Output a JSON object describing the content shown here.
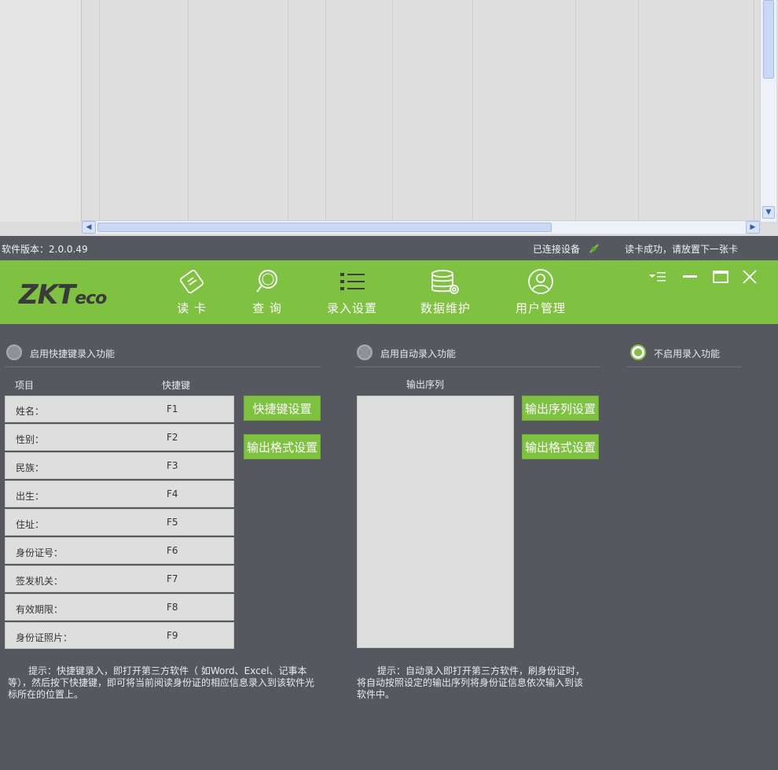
{
  "status": {
    "version": "软件版本：2.0.0.49",
    "connected": "已连接设备",
    "read_status": "读卡成功，请放置下一张卡"
  },
  "toolbar": {
    "logo_main": "ZKT",
    "logo_sub": "eco",
    "items": [
      {
        "label": "读 卡",
        "icon": "id-card-icon"
      },
      {
        "label": "查 询",
        "icon": "magnifier-icon"
      },
      {
        "label": "录入设置",
        "icon": "checklist-icon"
      },
      {
        "label": "数据维护",
        "icon": "database-gear-icon"
      },
      {
        "label": "用户管理",
        "icon": "user-icon"
      }
    ]
  },
  "panel": {
    "radio_hotkey": "启用快捷键录入功能",
    "radio_auto": "启用自动录入功能",
    "radio_off": "不启用录入功能",
    "selected": "radio_off",
    "col_item": "项目",
    "col_key": "快捷键",
    "rows": [
      {
        "name": "姓名：",
        "key": "F1"
      },
      {
        "name": "性别：",
        "key": "F2"
      },
      {
        "name": "民族：",
        "key": "F3"
      },
      {
        "name": "出生：",
        "key": "F4"
      },
      {
        "name": "住址：",
        "key": "F5"
      },
      {
        "name": "身份证号：",
        "key": "F6"
      },
      {
        "name": "签发机关：",
        "key": "F7"
      },
      {
        "name": "有效期限：",
        "key": "F8"
      },
      {
        "name": "身份证照片：",
        "key": "F9"
      }
    ],
    "btn_hotkey_set": "快捷键设置",
    "btn_format_left": "输出格式设置",
    "output_label": "输出序列",
    "btn_seq_set": "输出序列设置",
    "btn_format_right": "输出格式设置",
    "hint_left": "提示：快捷键录入，即打开第三方软件（ 如Word、Excel、记事本等），然后按下快捷键，即可将当前阅读身份证的相应信息录入到该软件光标所在的位置上。",
    "hint_right": "提示：自动录入即打开第三方软件，刷身份证时，将自动按照设定的输出序列将身份证信息依次输入到该软件中。"
  },
  "colors": {
    "accent_green": "#7fc242",
    "panel_bg": "#55585f"
  }
}
